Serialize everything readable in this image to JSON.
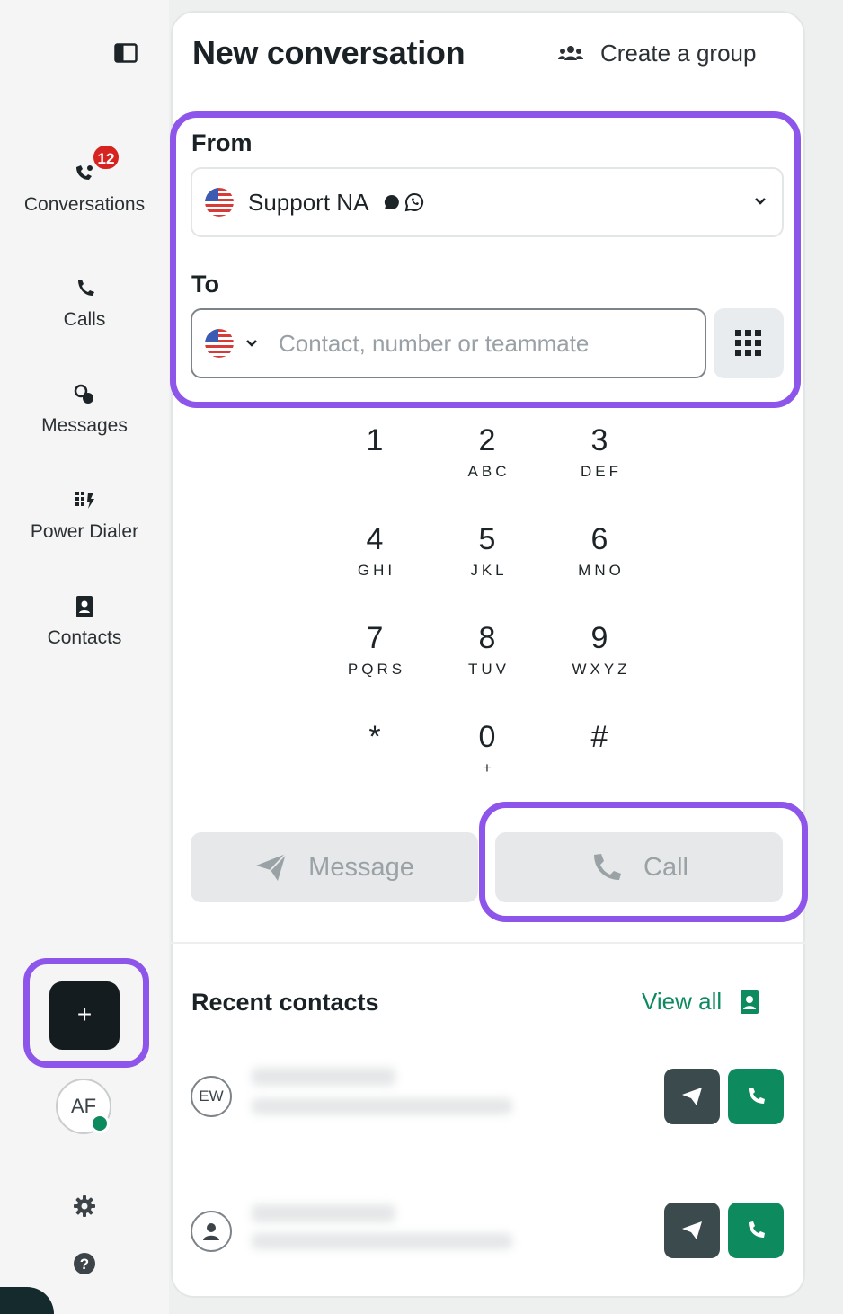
{
  "sidebar": {
    "items": [
      {
        "label": "Conversations",
        "badge": "12",
        "icon": "conversations-icon"
      },
      {
        "label": "Calls",
        "icon": "phone-icon"
      },
      {
        "label": "Messages",
        "icon": "messages-icon"
      },
      {
        "label": "Power Dialer",
        "icon": "power-dialer-icon"
      },
      {
        "label": "Contacts",
        "icon": "contacts-book-icon"
      }
    ],
    "new_button": "+",
    "avatar_initials": "AF"
  },
  "header": {
    "title": "New conversation",
    "create_group": "Create a group"
  },
  "form": {
    "from_label": "From",
    "from_value": "Support NA",
    "to_label": "To",
    "to_placeholder": "Contact, number or teammate"
  },
  "keypad": [
    {
      "digit": "1",
      "letters": ""
    },
    {
      "digit": "2",
      "letters": "ABC"
    },
    {
      "digit": "3",
      "letters": "DEF"
    },
    {
      "digit": "4",
      "letters": "GHI"
    },
    {
      "digit": "5",
      "letters": "JKL"
    },
    {
      "digit": "6",
      "letters": "MNO"
    },
    {
      "digit": "7",
      "letters": "PQRS"
    },
    {
      "digit": "8",
      "letters": "TUV"
    },
    {
      "digit": "9",
      "letters": "WXYZ"
    },
    {
      "digit": "*",
      "letters": ""
    },
    {
      "digit": "0",
      "letters": "+"
    },
    {
      "digit": "#",
      "letters": ""
    }
  ],
  "actions": {
    "message": "Message",
    "call": "Call"
  },
  "recent": {
    "title": "Recent contacts",
    "view_all": "View all",
    "contacts": [
      {
        "initials": "EW"
      },
      {
        "initials": ""
      }
    ]
  },
  "colors": {
    "accent_green": "#0e8a5f",
    "highlight_purple": "#8d55ea",
    "badge_red": "#d6231f",
    "dark": "#141c20"
  }
}
